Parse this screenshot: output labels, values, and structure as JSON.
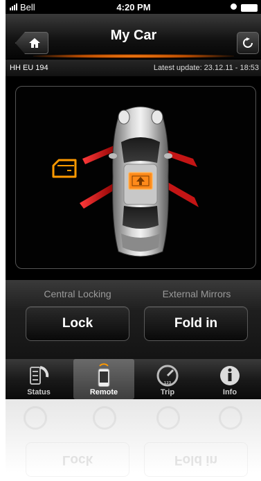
{
  "status_bar": {
    "carrier": "Bell",
    "time": "4:20 PM"
  },
  "nav": {
    "title": "My Car",
    "home_icon": "home-icon",
    "refresh_icon": "refresh-icon"
  },
  "info": {
    "plate": "HH EU 194",
    "latest_update": "Latest update: 23.12.11 - 18:53"
  },
  "car_view": {
    "door_icon_color": "#ff9900",
    "mirror_arrow_color": "#d21a1a",
    "lock_badge_color": "#ff8a1a"
  },
  "controls": {
    "central_locking_label": "Central Locking",
    "external_mirrors_label": "External Mirrors",
    "lock_button": "Lock",
    "fold_button": "Fold in"
  },
  "tabs": [
    {
      "label": "Status",
      "icon": "status-icon",
      "active": false
    },
    {
      "label": "Remote",
      "icon": "phone-remote-icon",
      "active": true
    },
    {
      "label": "Trip",
      "icon": "trip-gauge-icon",
      "active": false
    },
    {
      "label": "Info",
      "icon": "info-icon",
      "active": false
    }
  ],
  "reflection": {
    "lock_button": "Lock",
    "fold_button": "Fold in"
  }
}
